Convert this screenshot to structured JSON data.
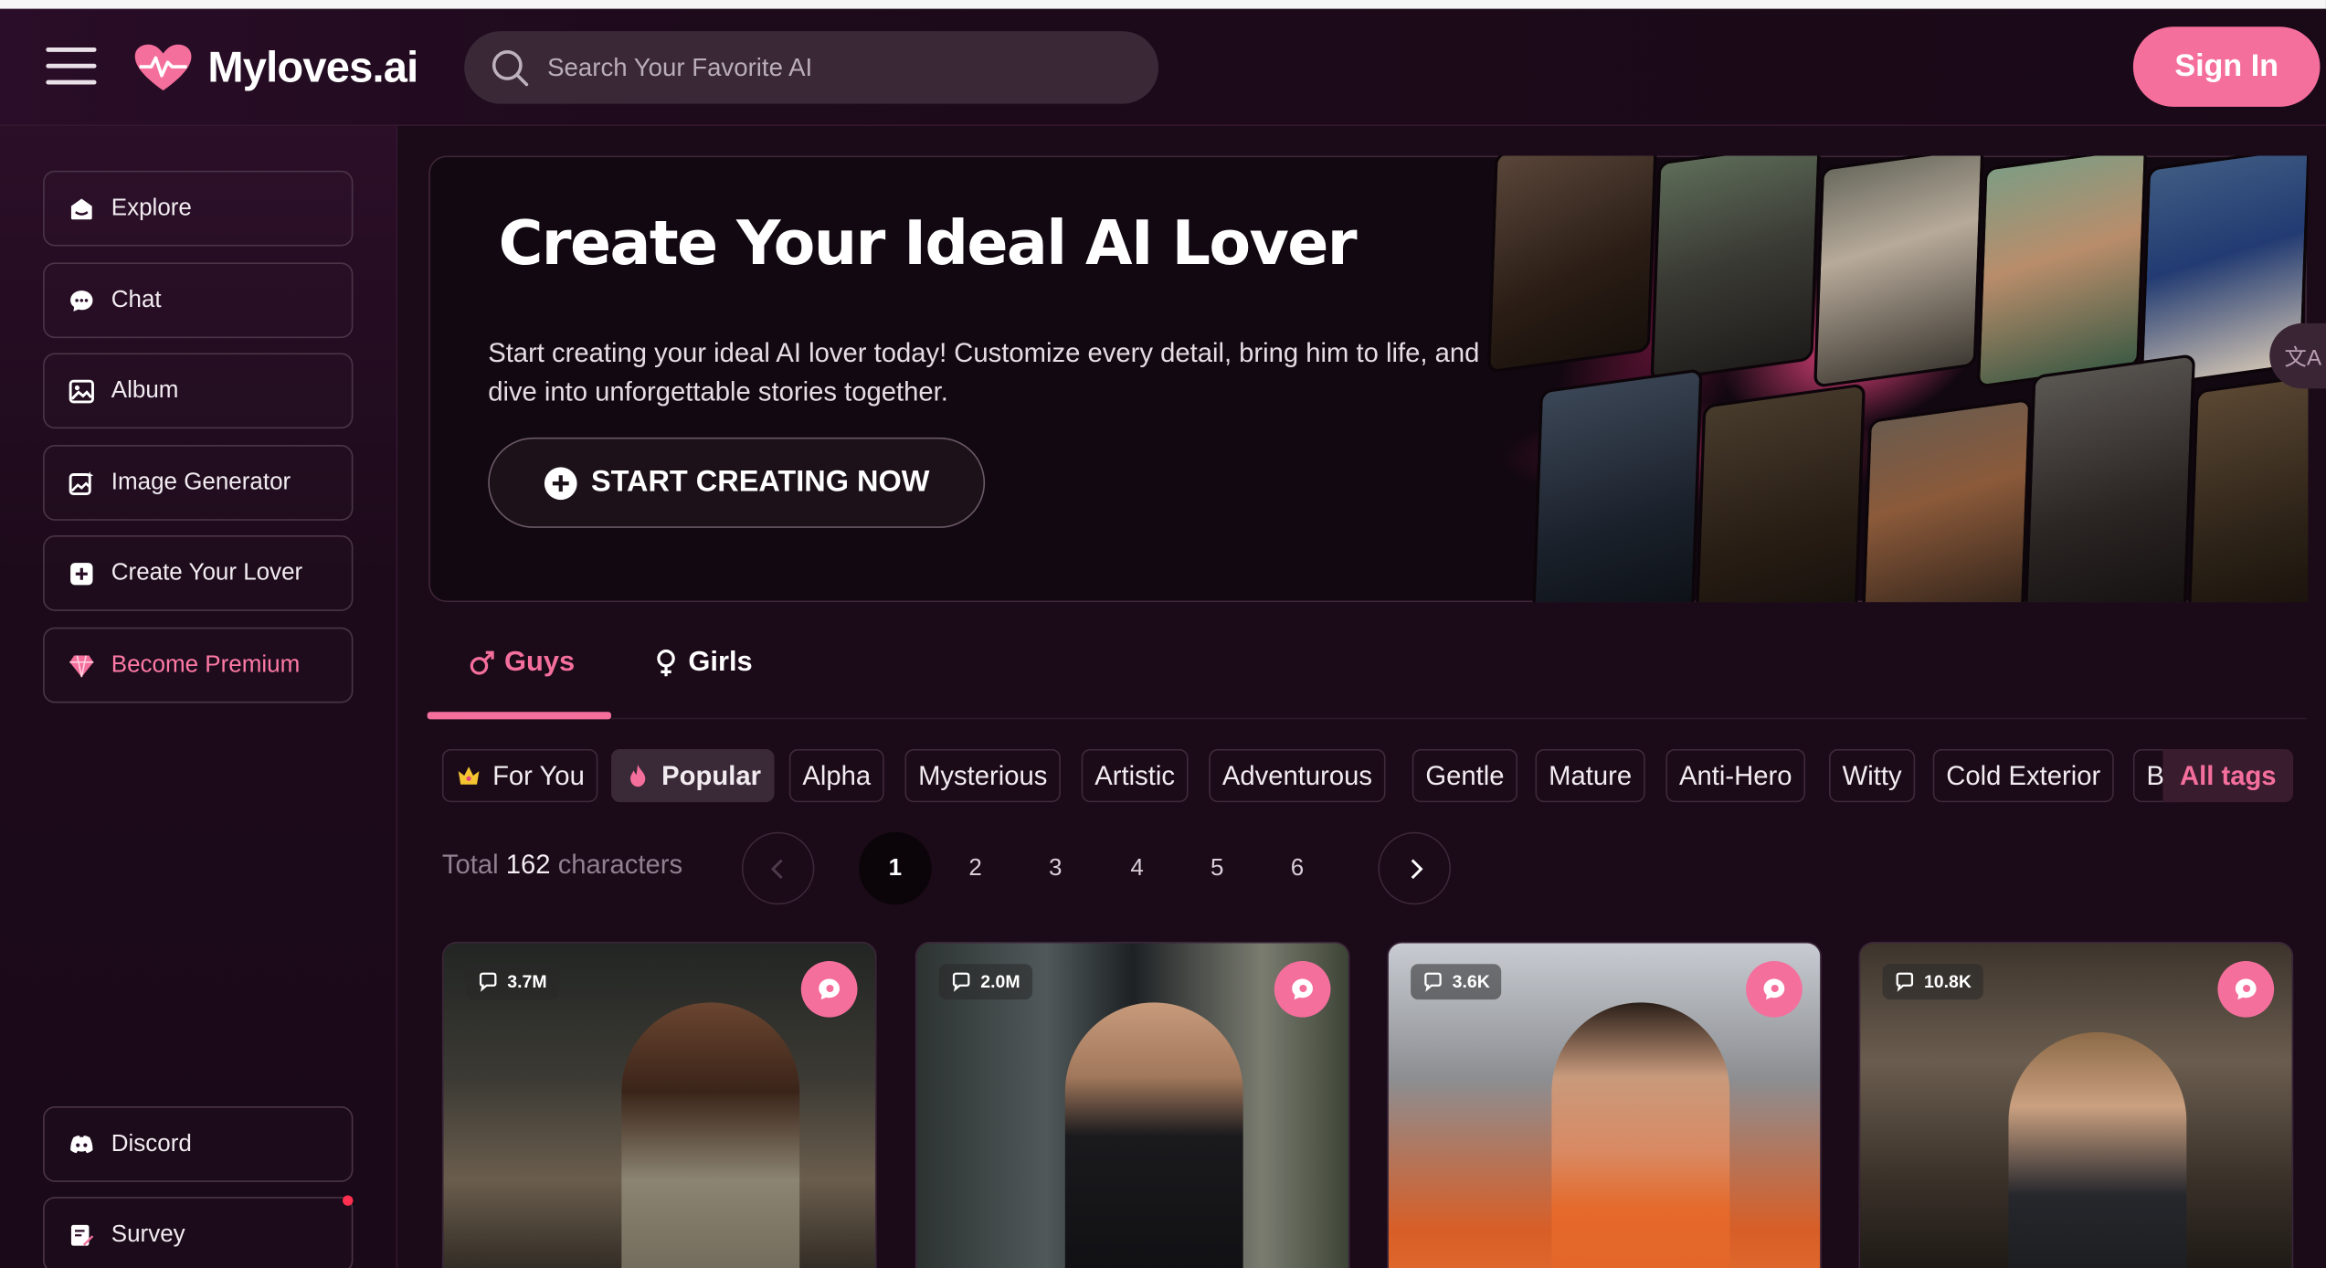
{
  "header": {
    "brand": "Myloves.ai",
    "search_placeholder": "Search Your Favorite AI",
    "signin_label": "Sign In"
  },
  "sidebar": {
    "items": [
      {
        "label": "Explore",
        "icon": "explore-icon"
      },
      {
        "label": "Chat",
        "icon": "chat-icon"
      },
      {
        "label": "Album",
        "icon": "album-icon"
      },
      {
        "label": "Image Generator",
        "icon": "image-generator-icon"
      },
      {
        "label": "Create Your Lover",
        "icon": "plus-square-icon"
      },
      {
        "label": "Become Premium",
        "icon": "diamond-icon"
      }
    ],
    "bottom_items": [
      {
        "label": "Discord",
        "icon": "discord-icon"
      },
      {
        "label": "Survey",
        "icon": "survey-icon"
      }
    ]
  },
  "banner": {
    "title_plain": "Create Your Ideal ",
    "title_highlight": "AI Lover",
    "description": "Start creating your ideal AI lover today! Customize every detail, bring him to life, and dive into unforgettable stories together.",
    "cta_label": "START CREATING NOW"
  },
  "side_float_label": "文A",
  "gender_tabs": [
    {
      "label": "Guys",
      "active": true
    },
    {
      "label": "Girls",
      "active": false
    }
  ],
  "tags": [
    "For You",
    "Popular",
    "Alpha",
    "Mysterious",
    "Artistic",
    "Adventurous",
    "Gentle",
    "Mature",
    "Anti-Hero",
    "Witty",
    "Cold Exterior",
    "Bc"
  ],
  "active_tag": "Popular",
  "all_tags_label": "All tags",
  "pagination": {
    "total_prefix": "Total",
    "total_count": "162",
    "total_suffix": "characters",
    "pages": [
      "1",
      "2",
      "3",
      "4",
      "5",
      "6"
    ],
    "current": "1"
  },
  "cards": [
    {
      "messages": "3.7M"
    },
    {
      "messages": "2.0M"
    },
    {
      "messages": "3.6K"
    },
    {
      "messages": "10.8K"
    }
  ],
  "colors": {
    "accent": "#f56f9d",
    "background": "#1b0a18",
    "search_bg": "#3a2837"
  }
}
